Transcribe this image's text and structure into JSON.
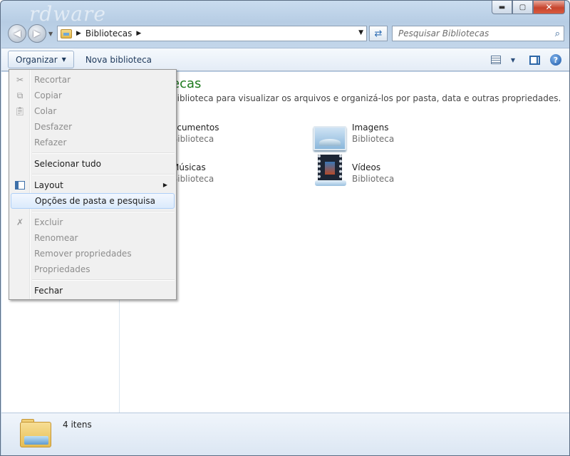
{
  "titlebar": {
    "watermark": "rdware"
  },
  "address": {
    "crumb": "Bibliotecas"
  },
  "search": {
    "placeholder": "Pesquisar Bibliotecas"
  },
  "toolbar": {
    "organize": "Organizar",
    "new_library": "Nova biblioteca"
  },
  "content": {
    "title_visible": "ecas",
    "description_visible": "biblioteca para visualizar os arquivos e organizá-los por pasta, data e outras propriedades.",
    "items": [
      {
        "name": "ocumentos",
        "type": "Biblioteca",
        "icon": "documents-library-icon"
      },
      {
        "name": "Imagens",
        "type": "Biblioteca",
        "icon": "pictures-library-icon"
      },
      {
        "name": "Músicas",
        "type": "Biblioteca",
        "icon": "music-library-icon"
      },
      {
        "name": "Vídeos",
        "type": "Biblioteca",
        "icon": "videos-library-icon"
      }
    ]
  },
  "menu": {
    "items": [
      {
        "label": "Recortar",
        "enabled": false,
        "icon": "scissors-icon"
      },
      {
        "label": "Copiar",
        "enabled": false,
        "icon": "copy-icon"
      },
      {
        "label": "Colar",
        "enabled": false,
        "icon": "paste-icon"
      },
      {
        "label": "Desfazer",
        "enabled": false
      },
      {
        "label": "Refazer",
        "enabled": false
      },
      {
        "label": "Selecionar tudo",
        "enabled": true
      },
      {
        "label": "Layout",
        "enabled": true,
        "icon": "layout-icon",
        "submenu": true
      },
      {
        "label": "Opções de pasta e pesquisa",
        "enabled": true,
        "highlighted": true
      },
      {
        "label": "Excluir",
        "enabled": false,
        "icon": "delete-icon"
      },
      {
        "label": "Renomear",
        "enabled": false
      },
      {
        "label": "Remover propriedades",
        "enabled": false
      },
      {
        "label": "Propriedades",
        "enabled": false
      },
      {
        "label": "Fechar",
        "enabled": true
      }
    ]
  },
  "status": {
    "count": "4 itens"
  },
  "colors": {
    "title_green": "#1d7a1d",
    "highlight": "#dbeafc"
  }
}
